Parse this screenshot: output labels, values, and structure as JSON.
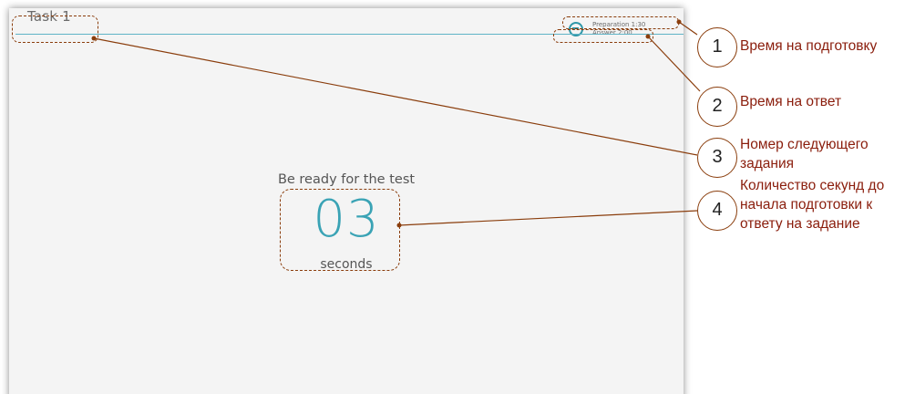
{
  "app": {
    "task_label": "Task 1",
    "timer": {
      "icon": "clock-icon",
      "preparation": "Preparation 1:30",
      "answer": "Answer 2:00"
    },
    "ready_text": "Be ready for the test",
    "countdown": "03",
    "countdown_unit": "seconds"
  },
  "callouts": [
    {
      "number": "1",
      "text": "Время на подготовку"
    },
    {
      "number": "2",
      "text": "Время на ответ"
    },
    {
      "number": "3",
      "text": "Номер следующего задания"
    },
    {
      "number": "4",
      "text": "Количество секунд до начала подготовки к ответу на задание"
    }
  ],
  "colors": {
    "accent": "#3aa3b5",
    "callout": "#8a3d0c",
    "callout_text": "#8a1d0c",
    "panel_bg": "#f4f4f4"
  }
}
